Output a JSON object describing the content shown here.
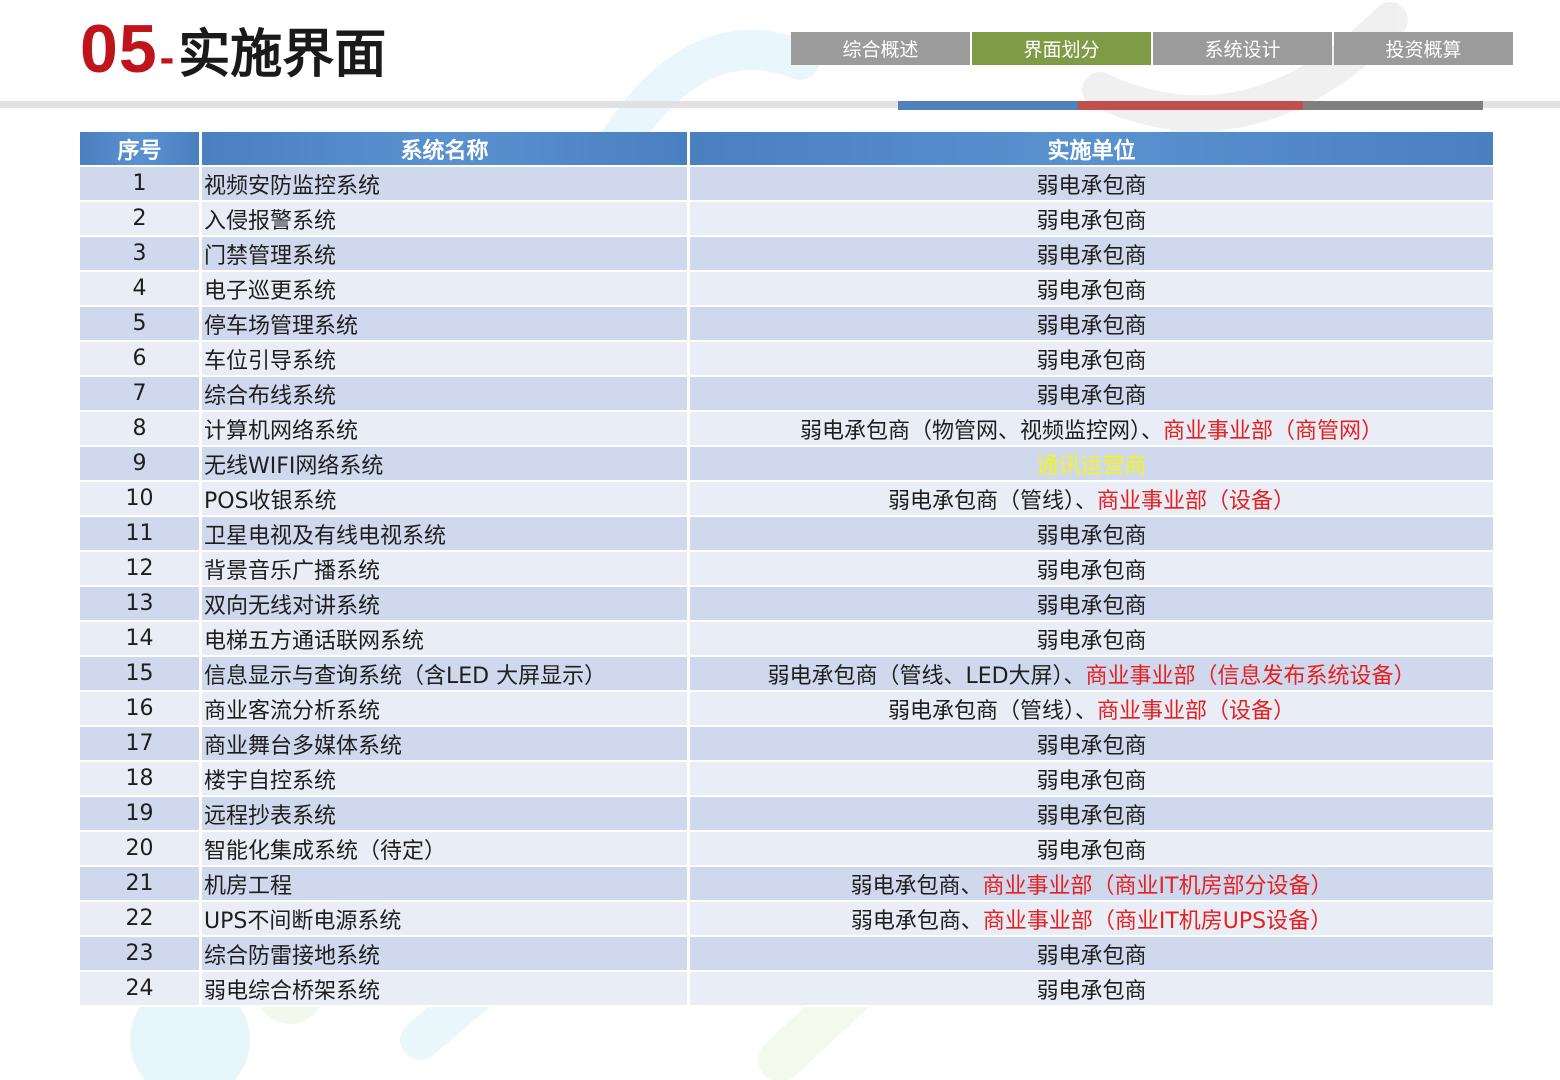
{
  "title": {
    "number": "05",
    "dash": "-",
    "text": "实施界面"
  },
  "tabs": [
    {
      "label": "综合概述",
      "active": false
    },
    {
      "label": "界面划分",
      "active": true
    },
    {
      "label": "系统设计",
      "active": false
    },
    {
      "label": "投资概算",
      "active": false
    }
  ],
  "colors": {
    "title_red": "#c0141c",
    "tab_gray": "#9b9b9b",
    "tab_active": "#7f9b46",
    "header_blue": "#4f81bd",
    "row_odd": "#cfd8ec",
    "row_even": "#e9edf6",
    "highlight_red": "#e52020",
    "highlight_yellow": "#f5f51e"
  },
  "table": {
    "headers": [
      "序号",
      "系统名称",
      "实施单位"
    ],
    "rows": [
      {
        "no": "1",
        "name": "视频安防监控系统",
        "unit": [
          {
            "text": "弱电承包商"
          }
        ]
      },
      {
        "no": "2",
        "name": "入侵报警系统",
        "unit": [
          {
            "text": "弱电承包商"
          }
        ]
      },
      {
        "no": "3",
        "name": "门禁管理系统",
        "unit": [
          {
            "text": "弱电承包商"
          }
        ]
      },
      {
        "no": "4",
        "name": "电子巡更系统",
        "unit": [
          {
            "text": "弱电承包商"
          }
        ]
      },
      {
        "no": "5",
        "name": "停车场管理系统",
        "unit": [
          {
            "text": "弱电承包商"
          }
        ]
      },
      {
        "no": "6",
        "name": "车位引导系统",
        "unit": [
          {
            "text": "弱电承包商"
          }
        ]
      },
      {
        "no": "7",
        "name": "综合布线系统",
        "unit": [
          {
            "text": "弱电承包商"
          }
        ]
      },
      {
        "no": "8",
        "name": "计算机网络系统",
        "unit": [
          {
            "text": "弱电承包商（物管网、视频监控网）、"
          },
          {
            "text": "商业事业部（商管网）",
            "color": "red"
          }
        ]
      },
      {
        "no": "9",
        "name": "无线WIFI网络系统",
        "unit": [
          {
            "text": "通讯运营商",
            "color": "yellow"
          }
        ]
      },
      {
        "no": "10",
        "name": "POS收银系统",
        "unit": [
          {
            "text": "弱电承包商（管线）、"
          },
          {
            "text": "商业事业部（设备）",
            "color": "red"
          }
        ]
      },
      {
        "no": "11",
        "name": "卫星电视及有线电视系统",
        "unit": [
          {
            "text": "弱电承包商"
          }
        ]
      },
      {
        "no": "12",
        "name": "背景音乐广播系统",
        "unit": [
          {
            "text": "弱电承包商"
          }
        ]
      },
      {
        "no": "13",
        "name": "双向无线对讲系统",
        "unit": [
          {
            "text": "弱电承包商"
          }
        ]
      },
      {
        "no": "14",
        "name": "电梯五方通话联网系统",
        "unit": [
          {
            "text": "弱电承包商"
          }
        ]
      },
      {
        "no": "15",
        "name": "信息显示与查询系统（含LED 大屏显示）",
        "unit": [
          {
            "text": "弱电承包商（管线、LED大屏）、"
          },
          {
            "text": "商业事业部（信息发布系统设备）",
            "color": "red"
          }
        ]
      },
      {
        "no": "16",
        "name": "商业客流分析系统",
        "unit": [
          {
            "text": "弱电承包商（管线）、"
          },
          {
            "text": "商业事业部（设备）",
            "color": "red"
          }
        ]
      },
      {
        "no": "17",
        "name": "商业舞台多媒体系统",
        "unit": [
          {
            "text": "弱电承包商"
          }
        ]
      },
      {
        "no": "18",
        "name": "楼宇自控系统",
        "unit": [
          {
            "text": "弱电承包商"
          }
        ]
      },
      {
        "no": "19",
        "name": "远程抄表系统",
        "unit": [
          {
            "text": "弱电承包商"
          }
        ]
      },
      {
        "no": "20",
        "name": "智能化集成系统（待定）",
        "unit": [
          {
            "text": "弱电承包商"
          }
        ]
      },
      {
        "no": "21",
        "name": "机房工程",
        "unit": [
          {
            "text": "弱电承包商、"
          },
          {
            "text": "商业事业部（商业IT机房部分设备）",
            "color": "red"
          }
        ]
      },
      {
        "no": "22",
        "name": "UPS不间断电源系统",
        "unit": [
          {
            "text": "弱电承包商、"
          },
          {
            "text": "商业事业部（商业IT机房UPS设备）",
            "color": "red"
          }
        ]
      },
      {
        "no": "23",
        "name": "综合防雷接地系统",
        "unit": [
          {
            "text": "弱电承包商"
          }
        ]
      },
      {
        "no": "24",
        "name": "弱电综合桥架系统",
        "unit": [
          {
            "text": "弱电承包商"
          }
        ]
      }
    ]
  }
}
